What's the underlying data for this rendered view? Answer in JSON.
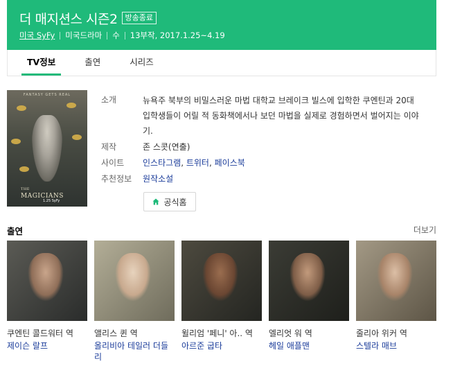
{
  "header": {
    "title": "더 매지션스 시즌2",
    "status_badge": "방송종료",
    "meta": {
      "network": "미국 SyFy",
      "genre": "미국드라마",
      "day": "수",
      "episodes_period": "13부작, 2017.1.25~4.19"
    }
  },
  "tabs": [
    {
      "label": "TV정보",
      "active": true
    },
    {
      "label": "출연",
      "active": false
    },
    {
      "label": "시리즈",
      "active": false
    }
  ],
  "poster": {
    "tagline": "FANTASY GETS REAL",
    "logo_small": "THE",
    "logo_main": "MAGICIANS",
    "date": "1.25 SyFy"
  },
  "info": {
    "synopsis_label": "소개",
    "synopsis": "뉴욕주 북부의 비밀스러운 마법 대학교 브레이크 빌스에 입학한 쿠엔틴과 20대 입학생들이 어릴 적 동화책에서나 보던 마법을 실제로 경험하면서 벌어지는 이야기.",
    "production_label": "제작",
    "production": "존 스콧(연출)",
    "site_label": "사이트",
    "sites": [
      "인스타그램",
      "트위터",
      "페이스북"
    ],
    "recommend_label": "추천정보",
    "recommend": "원작소설",
    "home_button": "공식홈"
  },
  "cast": {
    "title": "출연",
    "more": "더보기",
    "items": [
      {
        "role": "쿠엔틴 콜드워터 역",
        "name": "제이슨 랄프"
      },
      {
        "role": "앨리스 퀸 역",
        "name": "올리비아 테일러 더들리"
      },
      {
        "role": "윌리엄 '페니' 아.. 역",
        "name": "아르준 굽타"
      },
      {
        "role": "엘리엇 워 역",
        "name": "헤일 애플맨"
      },
      {
        "role": "줄리아 위커 역",
        "name": "스텔라 매브"
      }
    ]
  },
  "colors": {
    "brand_green": "#1fba7a",
    "link_blue": "#1b3c9a"
  }
}
